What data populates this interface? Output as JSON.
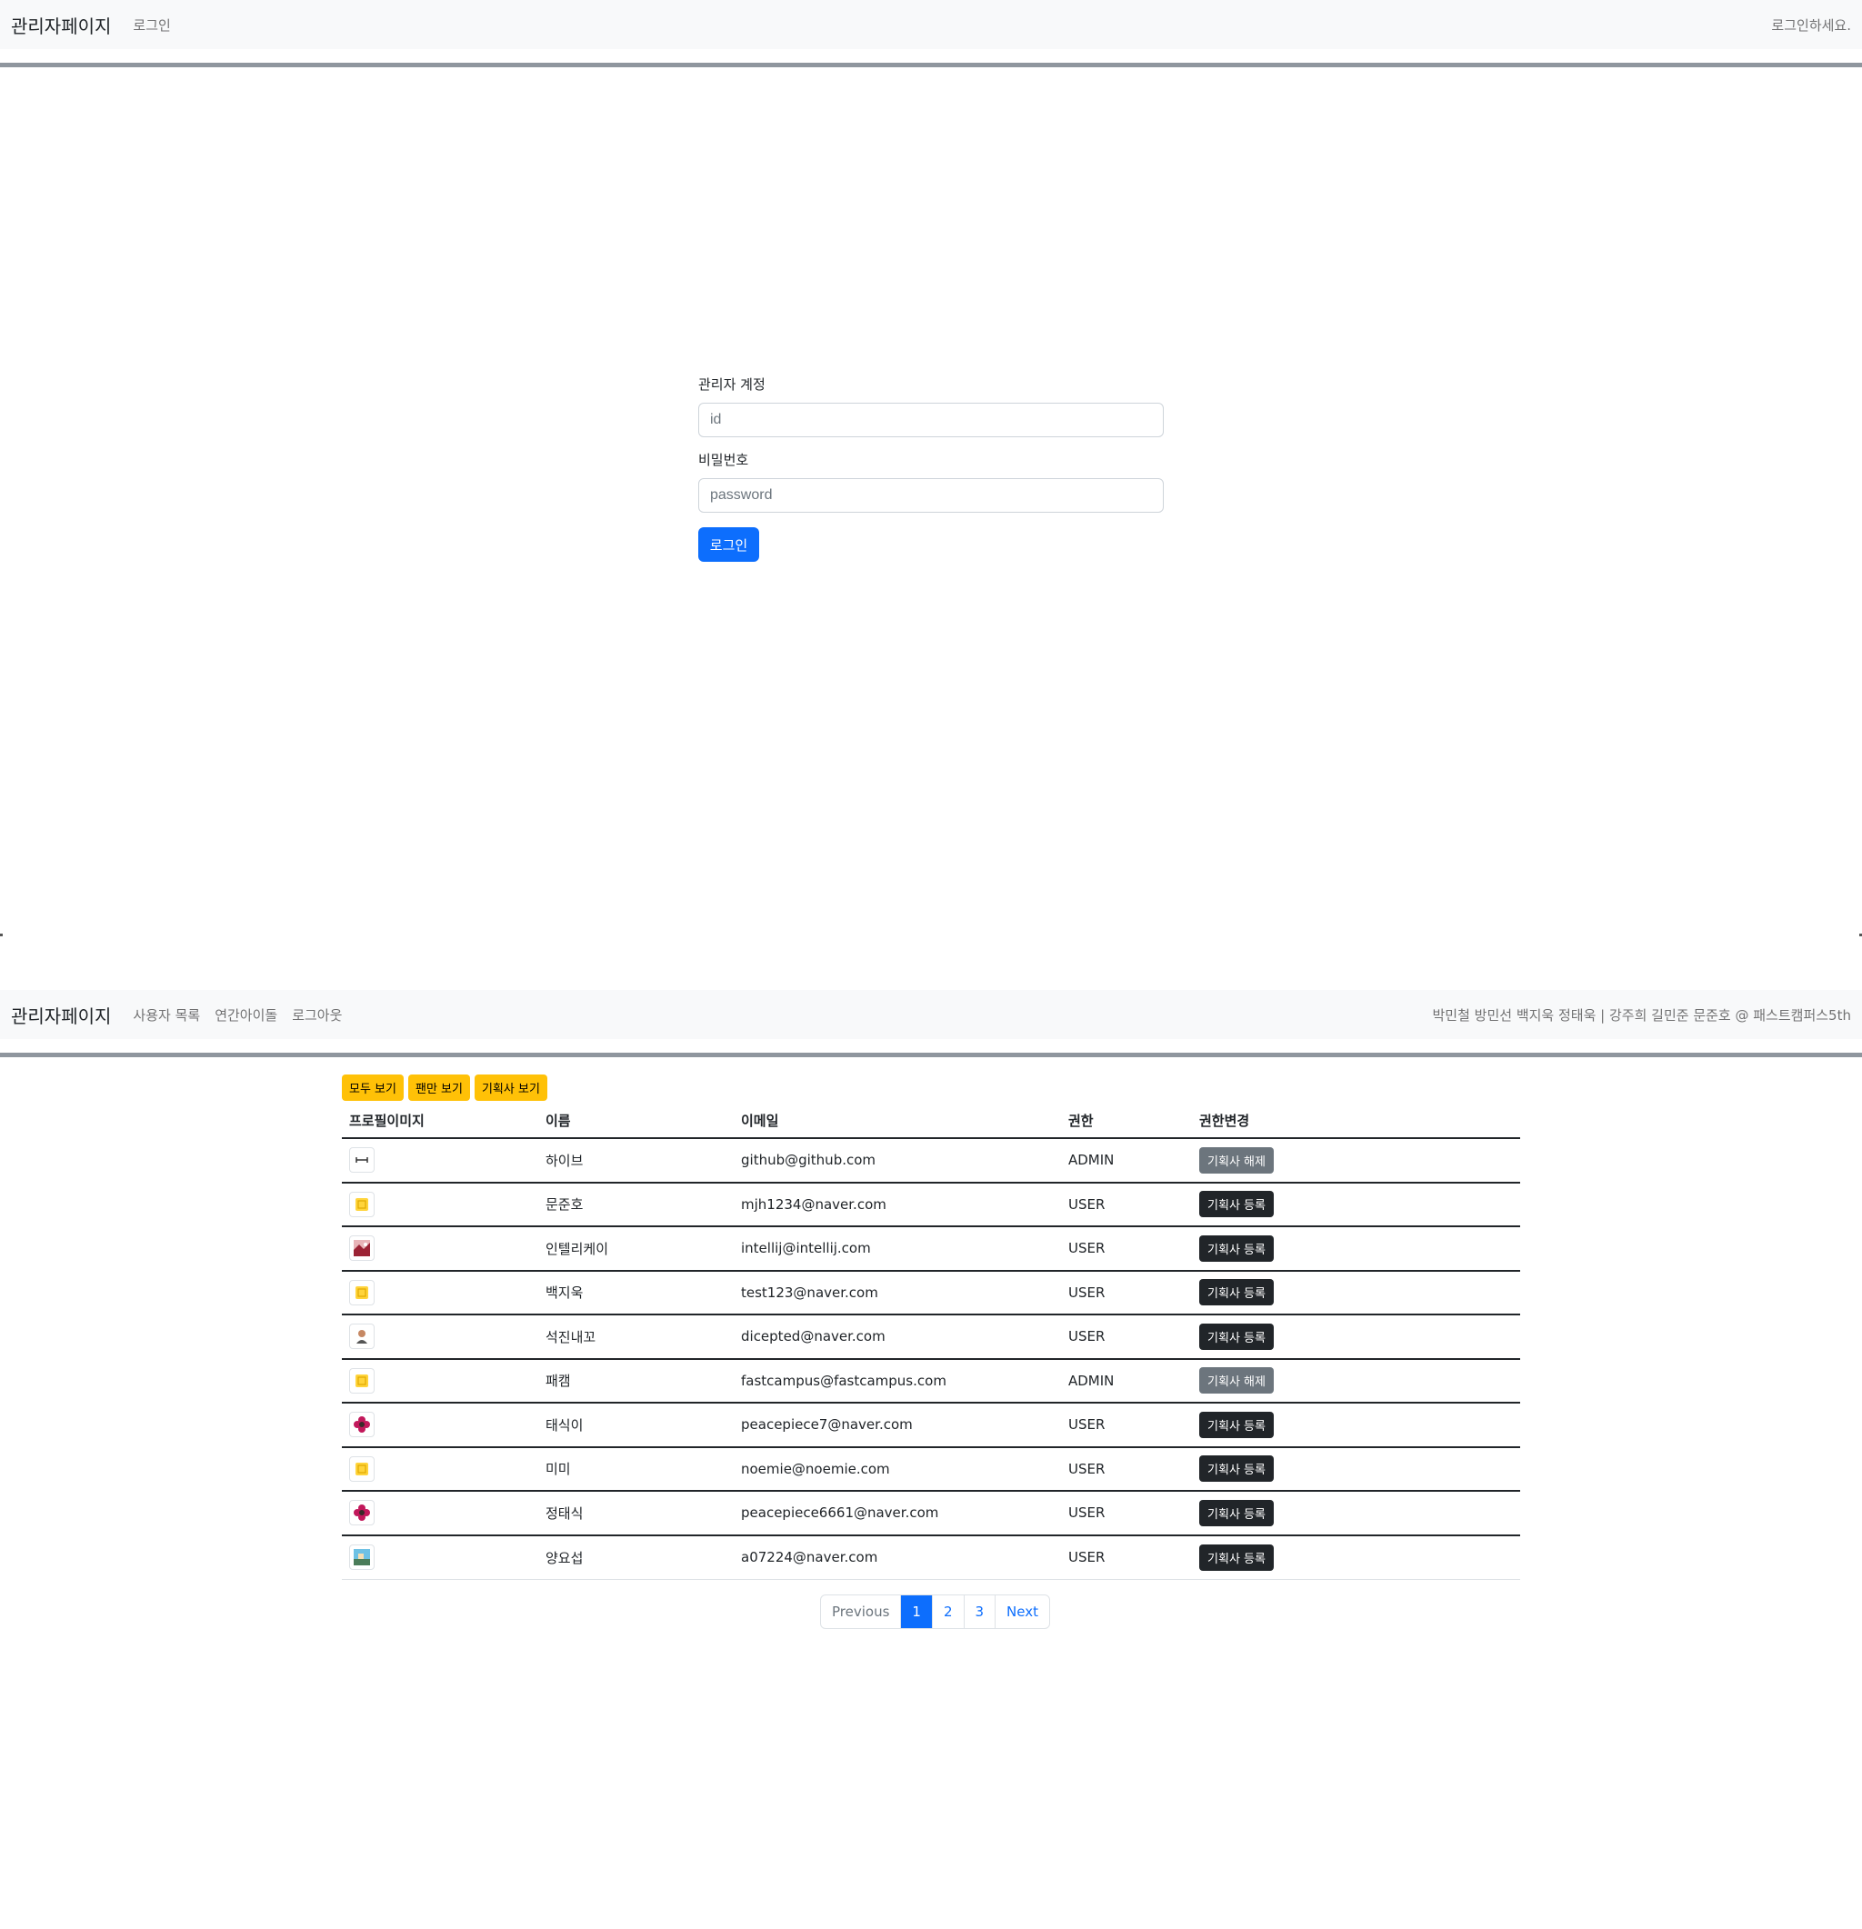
{
  "login_screen": {
    "navbar": {
      "brand": "관리자페이지",
      "links": [
        "로그인"
      ],
      "right_text": "로그인하세요."
    },
    "form": {
      "id_label": "관리자 계정",
      "id_placeholder": "id",
      "password_label": "비밀번호",
      "password_placeholder": "password",
      "submit_label": "로그인"
    }
  },
  "admin_screen": {
    "navbar": {
      "brand": "관리자페이지",
      "links": [
        "사용자 목록",
        "연간아이돌",
        "로그아웃"
      ],
      "right_text": "박민철 방민선 백지욱 정태욱 | 강주희 길민준 문준호 @ 패스트캠퍼스5th"
    },
    "filters": [
      "모두 보기",
      "팬만 보기",
      "기획사 보기"
    ],
    "table": {
      "headers": [
        "프로필이미지",
        "이름",
        "이메일",
        "권한",
        "권한변경"
      ],
      "rows": [
        {
          "avatar": "github-avatar",
          "name": "하이브",
          "email": "github@github.com",
          "role": "ADMIN",
          "action": "기획사 해제"
        },
        {
          "avatar": "default-avatar",
          "name": "문준호",
          "email": "mjh1234@naver.com",
          "role": "USER",
          "action": "기획사 등록"
        },
        {
          "avatar": "photo-avatar",
          "name": "인텔리케이",
          "email": "intellij@intellij.com",
          "role": "USER",
          "action": "기획사 등록"
        },
        {
          "avatar": "default-avatar",
          "name": "백지욱",
          "email": "test123@naver.com",
          "role": "USER",
          "action": "기획사 등록"
        },
        {
          "avatar": "person-avatar",
          "name": "석진내꼬",
          "email": "dicepted@naver.com",
          "role": "USER",
          "action": "기획사 등록"
        },
        {
          "avatar": "default-avatar",
          "name": "패캠",
          "email": "fastcampus@fastcampus.com",
          "role": "ADMIN",
          "action": "기획사 해제"
        },
        {
          "avatar": "flower-avatar",
          "name": "태식이",
          "email": "peacepiece7@naver.com",
          "role": "USER",
          "action": "기획사 등록"
        },
        {
          "avatar": "default-avatar",
          "name": "미미",
          "email": "noemie@noemie.com",
          "role": "USER",
          "action": "기획사 등록"
        },
        {
          "avatar": "flower-avatar",
          "name": "정태식",
          "email": "peacepiece6661@naver.com",
          "role": "USER",
          "action": "기획사 등록"
        },
        {
          "avatar": "landscape-avatar",
          "name": "양요섭",
          "email": "a07224@naver.com",
          "role": "USER",
          "action": "기획사 등록"
        }
      ]
    },
    "pagination": {
      "previous": "Previous",
      "pages": [
        "1",
        "2",
        "3"
      ],
      "active_page": "1",
      "next": "Next"
    }
  },
  "colors": {
    "primary": "#0d6efd",
    "warning": "#ffc107",
    "dark": "#212529",
    "secondary": "#6c757d",
    "navbar_bg": "#f8f9fa"
  }
}
